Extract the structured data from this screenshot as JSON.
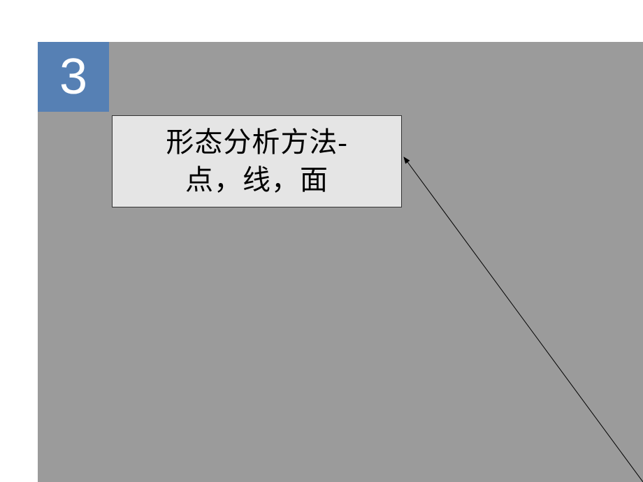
{
  "badge": {
    "number": "3"
  },
  "title": {
    "line1": "形态分析方法-",
    "line2": "点，线，面"
  }
}
